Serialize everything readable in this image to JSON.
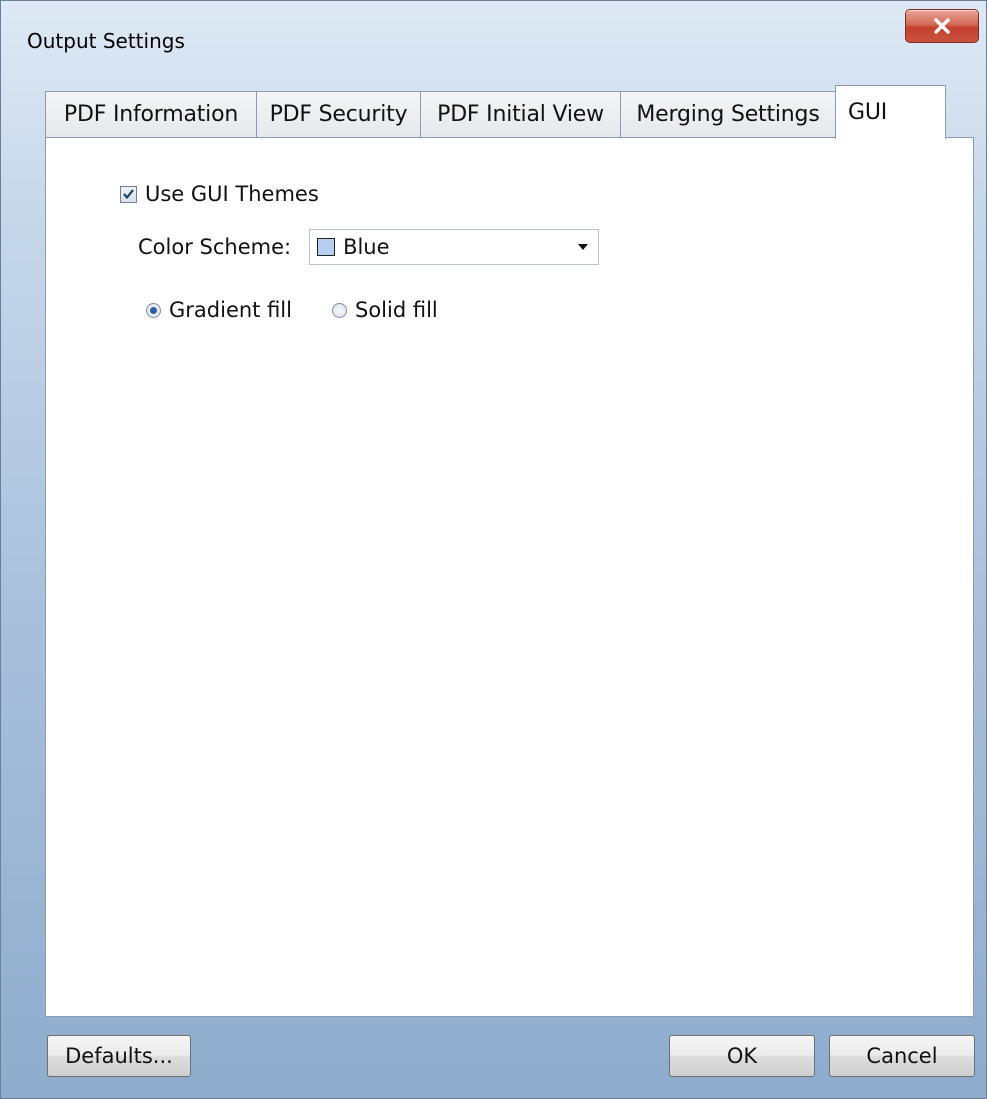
{
  "window": {
    "title": "Output Settings",
    "close_icon": "close-icon"
  },
  "tabs": [
    {
      "label": "PDF Information",
      "active": false
    },
    {
      "label": "PDF Security",
      "active": false
    },
    {
      "label": "PDF Initial View",
      "active": false
    },
    {
      "label": "Merging Settings",
      "active": false
    },
    {
      "label": "GUI",
      "active": true
    }
  ],
  "gui": {
    "use_themes": {
      "label": "Use GUI Themes",
      "checked": true
    },
    "color_scheme": {
      "label": "Color Scheme:",
      "value": "Blue",
      "swatch_color": "#b8cef0"
    },
    "fill": {
      "gradient_label": "Gradient fill",
      "solid_label": "Solid fill",
      "selected": "gradient"
    }
  },
  "buttons": {
    "defaults": "Defaults...",
    "ok": "OK",
    "cancel": "Cancel"
  }
}
